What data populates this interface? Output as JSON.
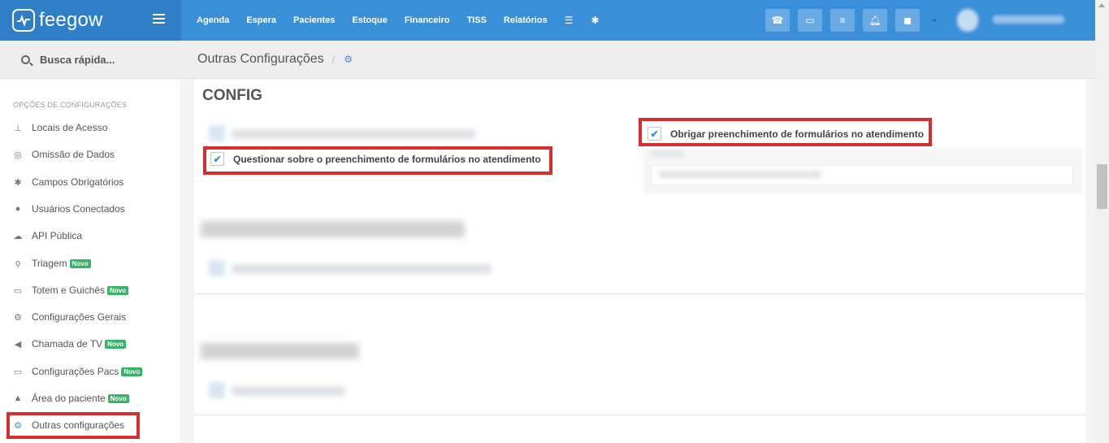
{
  "brand": {
    "name": "feegow"
  },
  "nav": {
    "items": [
      "Agenda",
      "Espera",
      "Pacientes",
      "Estoque",
      "Financeiro",
      "TISS",
      "Relatórios"
    ],
    "icons": [
      "database-icon",
      "gear-icon"
    ]
  },
  "topbar_buttons": [
    "phone-icon",
    "inbox-icon",
    "list-icon",
    "bell-icon",
    "chat-icon"
  ],
  "search": {
    "label": "Busca rápida..."
  },
  "sidebar": {
    "heading": "OPÇÕES DE CONFIGURAÇÕES",
    "items": [
      {
        "label": "Locais de Acesso",
        "icon": "pin-icon",
        "badge": ""
      },
      {
        "label": "Omissão de Dados",
        "icon": "eye-slash-icon",
        "badge": ""
      },
      {
        "label": "Campos Obrigatórios",
        "icon": "asterisk-icon",
        "badge": ""
      },
      {
        "label": "Usuários Conectados",
        "icon": "user-icon",
        "badge": ""
      },
      {
        "label": "API Pública",
        "icon": "cloud-icon",
        "badge": ""
      },
      {
        "label": "Triagem",
        "icon": "stethoscope-icon",
        "badge": "Novo"
      },
      {
        "label": "Totem e Guichês",
        "icon": "laptop-icon",
        "badge": "Novo"
      },
      {
        "label": "Configurações Gerais",
        "icon": "gears-icon",
        "badge": ""
      },
      {
        "label": "Chamada de TV",
        "icon": "megaphone-icon",
        "badge": "Novo"
      },
      {
        "label": "Configurações Pacs",
        "icon": "laptop-icon",
        "badge": "Novo"
      },
      {
        "label": "Área do paciente",
        "icon": "flask-icon",
        "badge": "Novo"
      },
      {
        "label": "Outras configurações",
        "icon": "gears-icon",
        "badge": ""
      }
    ]
  },
  "breadcrumb": {
    "title": "Outras Configurações",
    "separator": "/"
  },
  "content": {
    "section_title": "CONFIG",
    "option_left": "Questionar sobre o preenchimento de formulários no atendimento",
    "option_right": "Obrigar preenchimento de formulários no atendimento",
    "check_mark": "✔"
  },
  "colors": {
    "topbar": "#3a8fd9",
    "brand": "#2f7fc8",
    "highlight": "#d32f2f",
    "badge": "#3ab36a"
  }
}
